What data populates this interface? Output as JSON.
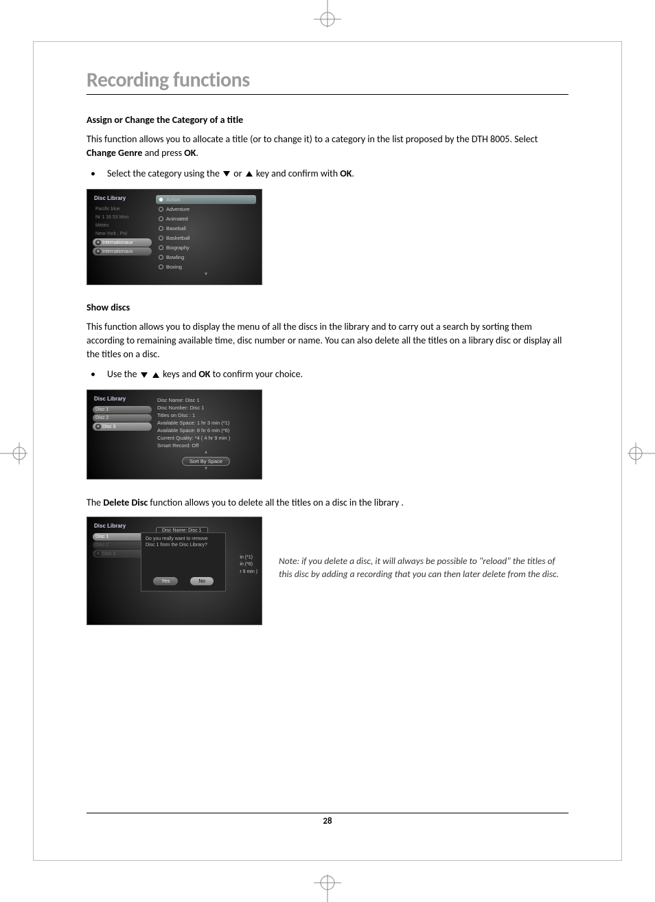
{
  "page": {
    "title": "Recording functions",
    "number": "28"
  },
  "section_assign": {
    "heading": "Assign or Change the Category of a title",
    "para": "This function allows you to allocate a title (or to change it) to a category in the list proposed by the DTH 8005. Select ",
    "para_b1": "Change Genre",
    "para_mid": " and press ",
    "para_b2": "OK",
    "para_end": ".",
    "bullet_pre": "Select the category using the ",
    "bullet_mid": " or ",
    "bullet_post": " key and confirm with ",
    "bullet_b": "OK",
    "bullet_end": "."
  },
  "shot_genre": {
    "title": "Disc Library",
    "left_items": [
      "Pacific blue",
      "Nr 1 16 53 Mon",
      "Météo",
      "New-York : Pol",
      "Internationaux",
      "Internationaux"
    ],
    "left_selected_index": 4,
    "genres": [
      "Action",
      "Adventure",
      "Animated",
      "Baseball",
      "Basketball",
      "Biography",
      "Bowling",
      "Boxing"
    ],
    "genre_selected_index": 0
  },
  "section_show": {
    "heading": "Show discs",
    "para": "This function allows you to display the menu of all the discs in the library and to carry out a search by sorting them according to remaining available time, disc number or name. You can also delete all the titles on a library disc or display all the titles on a disc.",
    "bullet_pre": "Use the ",
    "bullet_mid": " keys and ",
    "bullet_b": "OK",
    "bullet_post": " to confirm your choice."
  },
  "shot_discs": {
    "title": "Disc Library",
    "items": [
      "Disc 1",
      "Disc 2",
      "Disc 3"
    ],
    "selected_index": 2,
    "info_lines": [
      "Disc Name:  Disc 1",
      "Disc Number: Disc 1",
      "Titles on Disc : 1",
      "Available Space: 1 hr 3 min (*1)",
      "Available Space: 8 hr 6 min (*6)",
      "Current Quality: *4 ( 4 hr 9 min )",
      "Smart Record: Off"
    ],
    "sort_button": "Sort By Space"
  },
  "delete_para_pre": "The ",
  "delete_para_b": "Delete Disc",
  "delete_para_post": " function allows you to delete all the titles on a disc in the library .",
  "shot_delete": {
    "title": "Disc Library",
    "head_pill": "Disc Name:  Disc 1",
    "items": [
      "Disc 1",
      "Disc 2",
      "Disc 3"
    ],
    "dialog_line1": "Do you really want to remove",
    "dialog_line2": "Disc 1 from the Disc Library?",
    "yes": "Yes",
    "no": "No",
    "side_frag": [
      "in (*1)",
      "in (*6)",
      "r 9 min )"
    ]
  },
  "note": "Note: if you delete a disc, it will always be possible to \"reload\" the titles of this disc by adding a recording that you can then later delete from the disc."
}
